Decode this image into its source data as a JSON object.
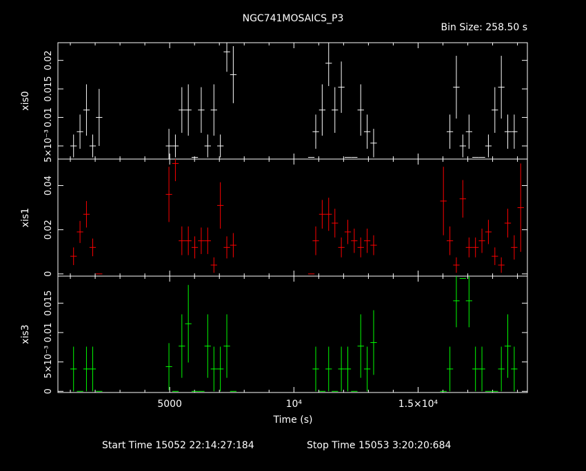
{
  "chart_data": {
    "type": "scatter",
    "title": "NGC741MOSAICS_P3",
    "bin_size_label": "Bin Size: 258.50 s",
    "xlabel": "Time (s)",
    "xlim": [
      500,
      19400
    ],
    "x_ticks": [
      {
        "value": 5000,
        "label": "5000"
      },
      {
        "value": 10000,
        "label": "10⁴"
      },
      {
        "value": 15000,
        "label": "1.5×10⁴"
      }
    ],
    "footer": {
      "start": "Start Time 15052 22:14:27:184",
      "stop": "Stop Time 15053  3:20:20:684"
    },
    "x_error": 129,
    "panels": [
      {
        "name": "xis0",
        "ylabel": "xis0",
        "color": "#ffffff",
        "ylim": [
          0.0027,
          0.0231
        ],
        "y_ticks": [
          {
            "value": 0.005,
            "label": "5×10⁻³"
          },
          {
            "value": 0.01,
            "label": "0.01"
          },
          {
            "value": 0.015,
            "label": "0.015"
          },
          {
            "value": 0.02,
            "label": "0.02"
          }
        ],
        "points": [
          {
            "x": 1130,
            "y": 0.005,
            "yerr": 0.002
          },
          {
            "x": 1390,
            "y": 0.0075,
            "yerr": 0.003
          },
          {
            "x": 1650,
            "y": 0.0113,
            "yerr": 0.0045
          },
          {
            "x": 1900,
            "y": 0.005,
            "yerr": 0.002
          },
          {
            "x": 2160,
            "y": 0.01,
            "yerr": 0.005
          },
          {
            "x": 4970,
            "y": 0.005,
            "yerr": 0.003
          },
          {
            "x": 5230,
            "y": 0.005,
            "yerr": 0.002
          },
          {
            "x": 5490,
            "y": 0.0113,
            "yerr": 0.004
          },
          {
            "x": 5750,
            "y": 0.0113,
            "yerr": 0.0045
          },
          {
            "x": 6010,
            "y": 0.003,
            "yerr": 0.0
          },
          {
            "x": 6270,
            "y": 0.0113,
            "yerr": 0.004
          },
          {
            "x": 6530,
            "y": 0.005,
            "yerr": 0.002
          },
          {
            "x": 6780,
            "y": 0.0113,
            "yerr": 0.0045
          },
          {
            "x": 7040,
            "y": 0.005,
            "yerr": 0.002
          },
          {
            "x": 7300,
            "y": 0.0215,
            "yerr": 0.0035
          },
          {
            "x": 7560,
            "y": 0.0175,
            "yerr": 0.005
          },
          {
            "x": 10700,
            "y": 0.003,
            "yerr": 0.0
          },
          {
            "x": 10880,
            "y": 0.0075,
            "yerr": 0.003
          },
          {
            "x": 11140,
            "y": 0.0113,
            "yerr": 0.0045
          },
          {
            "x": 11400,
            "y": 0.0195,
            "yerr": 0.004
          },
          {
            "x": 11650,
            "y": 0.0113,
            "yerr": 0.004
          },
          {
            "x": 11910,
            "y": 0.0153,
            "yerr": 0.0045
          },
          {
            "x": 12170,
            "y": 0.003,
            "yerr": 0.0
          },
          {
            "x": 12430,
            "y": 0.003,
            "yerr": 0.0
          },
          {
            "x": 12690,
            "y": 0.0113,
            "yerr": 0.0045
          },
          {
            "x": 12950,
            "y": 0.0075,
            "yerr": 0.003
          },
          {
            "x": 13210,
            "y": 0.0055,
            "yerr": 0.0025
          },
          {
            "x": 16280,
            "y": 0.0075,
            "yerr": 0.003
          },
          {
            "x": 16540,
            "y": 0.0153,
            "yerr": 0.0055
          },
          {
            "x": 16800,
            "y": 0.005,
            "yerr": 0.002
          },
          {
            "x": 17050,
            "y": 0.0075,
            "yerr": 0.003
          },
          {
            "x": 17310,
            "y": 0.003,
            "yerr": 0.0
          },
          {
            "x": 17570,
            "y": 0.003,
            "yerr": 0.0
          },
          {
            "x": 17830,
            "y": 0.005,
            "yerr": 0.002
          },
          {
            "x": 18090,
            "y": 0.0113,
            "yerr": 0.004
          },
          {
            "x": 18350,
            "y": 0.0153,
            "yerr": 0.0055
          },
          {
            "x": 18610,
            "y": 0.0075,
            "yerr": 0.003
          },
          {
            "x": 18870,
            "y": 0.0075,
            "yerr": 0.003
          }
        ]
      },
      {
        "name": "xis1",
        "ylabel": "xis1",
        "color": "#ff0000",
        "ylim": [
          -0.001,
          0.052
        ],
        "y_ticks": [
          {
            "value": 0,
            "label": "0"
          },
          {
            "value": 0.02,
            "label": "0.02"
          },
          {
            "value": 0.04,
            "label": "0.04"
          }
        ],
        "points": [
          {
            "x": 1130,
            "y": 0.008,
            "yerr": 0.004
          },
          {
            "x": 1390,
            "y": 0.019,
            "yerr": 0.005
          },
          {
            "x": 1650,
            "y": 0.027,
            "yerr": 0.006
          },
          {
            "x": 1900,
            "y": 0.012,
            "yerr": 0.004
          },
          {
            "x": 2160,
            "y": 0.0,
            "yerr": 0.0
          },
          {
            "x": 4970,
            "y": 0.036,
            "yerr": 0.0125
          },
          {
            "x": 5230,
            "y": 0.05,
            "yerr": 0.008
          },
          {
            "x": 5490,
            "y": 0.015,
            "yerr": 0.0065
          },
          {
            "x": 5750,
            "y": 0.015,
            "yerr": 0.0065
          },
          {
            "x": 6010,
            "y": 0.012,
            "yerr": 0.005
          },
          {
            "x": 6270,
            "y": 0.015,
            "yerr": 0.006
          },
          {
            "x": 6530,
            "y": 0.015,
            "yerr": 0.006
          },
          {
            "x": 6780,
            "y": 0.004,
            "yerr": 0.0035
          },
          {
            "x": 7040,
            "y": 0.031,
            "yerr": 0.0105
          },
          {
            "x": 7300,
            "y": 0.012,
            "yerr": 0.005
          },
          {
            "x": 7560,
            "y": 0.013,
            "yerr": 0.0055
          },
          {
            "x": 10700,
            "y": 0.0,
            "yerr": 0.0
          },
          {
            "x": 10880,
            "y": 0.015,
            "yerr": 0.0065
          },
          {
            "x": 11140,
            "y": 0.027,
            "yerr": 0.0065
          },
          {
            "x": 11400,
            "y": 0.027,
            "yerr": 0.0075
          },
          {
            "x": 11650,
            "y": 0.023,
            "yerr": 0.0065
          },
          {
            "x": 11910,
            "y": 0.012,
            "yerr": 0.0045
          },
          {
            "x": 12170,
            "y": 0.019,
            "yerr": 0.0055
          },
          {
            "x": 12430,
            "y": 0.015,
            "yerr": 0.0055
          },
          {
            "x": 12690,
            "y": 0.012,
            "yerr": 0.0045
          },
          {
            "x": 12950,
            "y": 0.015,
            "yerr": 0.0055
          },
          {
            "x": 13210,
            "y": 0.013,
            "yerr": 0.0045
          },
          {
            "x": 16020,
            "y": 0.033,
            "yerr": 0.0155
          },
          {
            "x": 16280,
            "y": 0.015,
            "yerr": 0.0065
          },
          {
            "x": 16540,
            "y": 0.004,
            "yerr": 0.0035
          },
          {
            "x": 16800,
            "y": 0.034,
            "yerr": 0.0085
          },
          {
            "x": 17050,
            "y": 0.012,
            "yerr": 0.0045
          },
          {
            "x": 17310,
            "y": 0.012,
            "yerr": 0.0045
          },
          {
            "x": 17570,
            "y": 0.015,
            "yerr": 0.0055
          },
          {
            "x": 17830,
            "y": 0.019,
            "yerr": 0.0055
          },
          {
            "x": 18090,
            "y": 0.008,
            "yerr": 0.004
          },
          {
            "x": 18350,
            "y": 0.004,
            "yerr": 0.0035
          },
          {
            "x": 18610,
            "y": 0.023,
            "yerr": 0.0065
          },
          {
            "x": 18870,
            "y": 0.012,
            "yerr": 0.0055
          },
          {
            "x": 19130,
            "y": 0.03,
            "yerr": 0.02
          }
        ]
      },
      {
        "name": "xis3",
        "ylabel": "xis3",
        "color": "#00ff00",
        "ylim": [
          -0.0002,
          0.0196
        ],
        "y_ticks": [
          {
            "value": 0,
            "label": "0"
          },
          {
            "value": 0.005,
            "label": "5×10⁻³"
          },
          {
            "value": 0.01,
            "label": "0.01"
          },
          {
            "value": 0.015,
            "label": "0.015"
          }
        ],
        "points": [
          {
            "x": 1130,
            "y": 0.0038,
            "yerr": 0.0038
          },
          {
            "x": 1390,
            "y": 0.0,
            "yerr": 0.0
          },
          {
            "x": 1650,
            "y": 0.0038,
            "yerr": 0.0038
          },
          {
            "x": 1900,
            "y": 0.0038,
            "yerr": 0.0038
          },
          {
            "x": 2160,
            "y": 0.0,
            "yerr": 0.0
          },
          {
            "x": 4970,
            "y": 0.0042,
            "yerr": 0.004
          },
          {
            "x": 5230,
            "y": 0.0,
            "yerr": 0.0
          },
          {
            "x": 5490,
            "y": 0.0077,
            "yerr": 0.0054
          },
          {
            "x": 5750,
            "y": 0.0115,
            "yerr": 0.0066
          },
          {
            "x": 6010,
            "y": 0.0,
            "yerr": 0.0
          },
          {
            "x": 6270,
            "y": 0.0,
            "yerr": 0.0
          },
          {
            "x": 6530,
            "y": 0.0077,
            "yerr": 0.0054
          },
          {
            "x": 6780,
            "y": 0.0038,
            "yerr": 0.0038
          },
          {
            "x": 7040,
            "y": 0.0038,
            "yerr": 0.0038
          },
          {
            "x": 7300,
            "y": 0.0077,
            "yerr": 0.0054
          },
          {
            "x": 7560,
            "y": 0.0,
            "yerr": 0.0
          },
          {
            "x": 10880,
            "y": 0.0038,
            "yerr": 0.0038
          },
          {
            "x": 11140,
            "y": 0.0,
            "yerr": 0.0
          },
          {
            "x": 11400,
            "y": 0.0038,
            "yerr": 0.0038
          },
          {
            "x": 11650,
            "y": 0.0,
            "yerr": 0.0
          },
          {
            "x": 11910,
            "y": 0.0038,
            "yerr": 0.0038
          },
          {
            "x": 12170,
            "y": 0.0038,
            "yerr": 0.0038
          },
          {
            "x": 12430,
            "y": 0.0,
            "yerr": 0.0
          },
          {
            "x": 12690,
            "y": 0.0077,
            "yerr": 0.0054
          },
          {
            "x": 12950,
            "y": 0.0038,
            "yerr": 0.0038
          },
          {
            "x": 13210,
            "y": 0.0083,
            "yerr": 0.0055
          },
          {
            "x": 16020,
            "y": 0.0,
            "yerr": 0.0
          },
          {
            "x": 16280,
            "y": 0.0038,
            "yerr": 0.0038
          },
          {
            "x": 16540,
            "y": 0.0154,
            "yerr": 0.0045
          },
          {
            "x": 16800,
            "y": 0.0192,
            "yerr": 0.0
          },
          {
            "x": 17050,
            "y": 0.0154,
            "yerr": 0.0045
          },
          {
            "x": 17310,
            "y": 0.0038,
            "yerr": 0.0038
          },
          {
            "x": 17570,
            "y": 0.0038,
            "yerr": 0.0038
          },
          {
            "x": 17830,
            "y": 0.0,
            "yerr": 0.0
          },
          {
            "x": 18090,
            "y": 0.0,
            "yerr": 0.0
          },
          {
            "x": 18350,
            "y": 0.0038,
            "yerr": 0.0038
          },
          {
            "x": 18610,
            "y": 0.0077,
            "yerr": 0.0054
          },
          {
            "x": 18870,
            "y": 0.0038,
            "yerr": 0.0038
          }
        ]
      }
    ]
  }
}
